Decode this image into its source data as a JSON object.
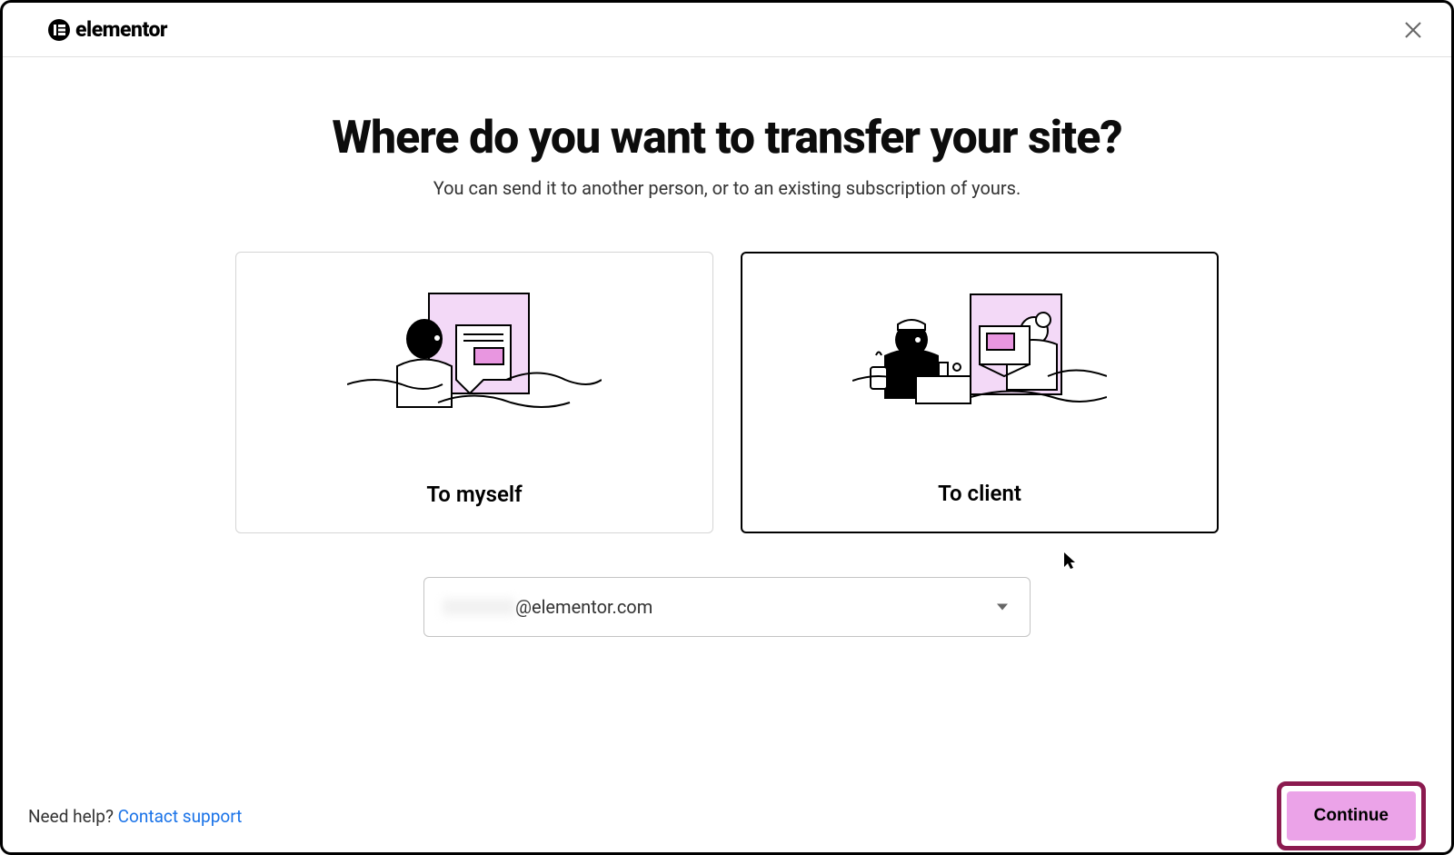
{
  "header": {
    "logo_text": "elementor"
  },
  "main": {
    "title": "Where do you want to transfer your site?",
    "subtitle": "You can send it to another person, or to an existing subscription of yours.",
    "options": [
      {
        "label": "To myself",
        "selected": false
      },
      {
        "label": "To client",
        "selected": true
      }
    ],
    "email_select": {
      "value_suffix": "@elementor.com"
    }
  },
  "footer": {
    "help_prefix": "Need help? ",
    "help_link": "Contact support",
    "continue_label": "Continue"
  }
}
